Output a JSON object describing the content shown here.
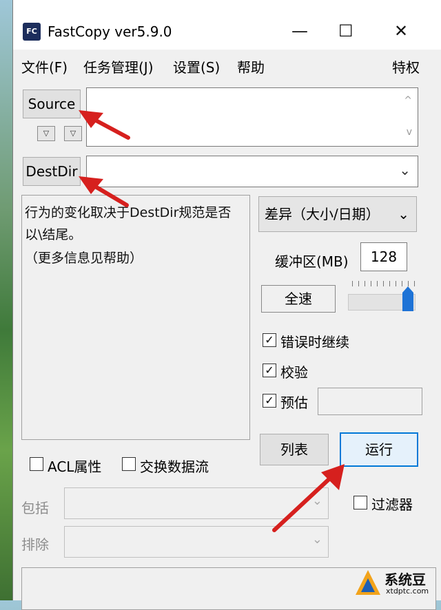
{
  "window": {
    "title": "FastCopy ver5.9.0",
    "icon_text": "FC",
    "minimize": "—",
    "maximize": "☐",
    "close": "✕"
  },
  "menu": {
    "file": "文件(F)",
    "task": "任务管理(J)",
    "settings": "设置(S)",
    "help": "帮助",
    "privilege": "特权"
  },
  "source": {
    "button": "Source",
    "value": ""
  },
  "destdir": {
    "button": "DestDir",
    "value": ""
  },
  "info_text": {
    "line1": "行为的变化取决于DestDir规范是否",
    "line2": "以\\结尾。",
    "line3": "（更多信息见帮助）"
  },
  "mode": {
    "selected": "差异（大小/日期）"
  },
  "buffer": {
    "label": "缓冲区(MB)",
    "value": "128"
  },
  "speed": {
    "label": "全速",
    "slider_level": 1.0
  },
  "options": {
    "continue_on_error": {
      "label": "错误时继续",
      "checked": "✓"
    },
    "verify": {
      "label": "校验",
      "checked": "✓"
    },
    "estimate": {
      "label": "预估",
      "checked": "✓"
    }
  },
  "actions": {
    "list": "列表",
    "run": "运行"
  },
  "extra": {
    "acl": "ACL属性",
    "streams": "交换数据流",
    "include": "包括",
    "exclude": "排除",
    "filter": "过滤器"
  },
  "watermark": {
    "brand": "系统豆",
    "site": "xtdptc.com"
  },
  "colors": {
    "accent": "#1e73d6",
    "arrow": "#d6201e"
  }
}
